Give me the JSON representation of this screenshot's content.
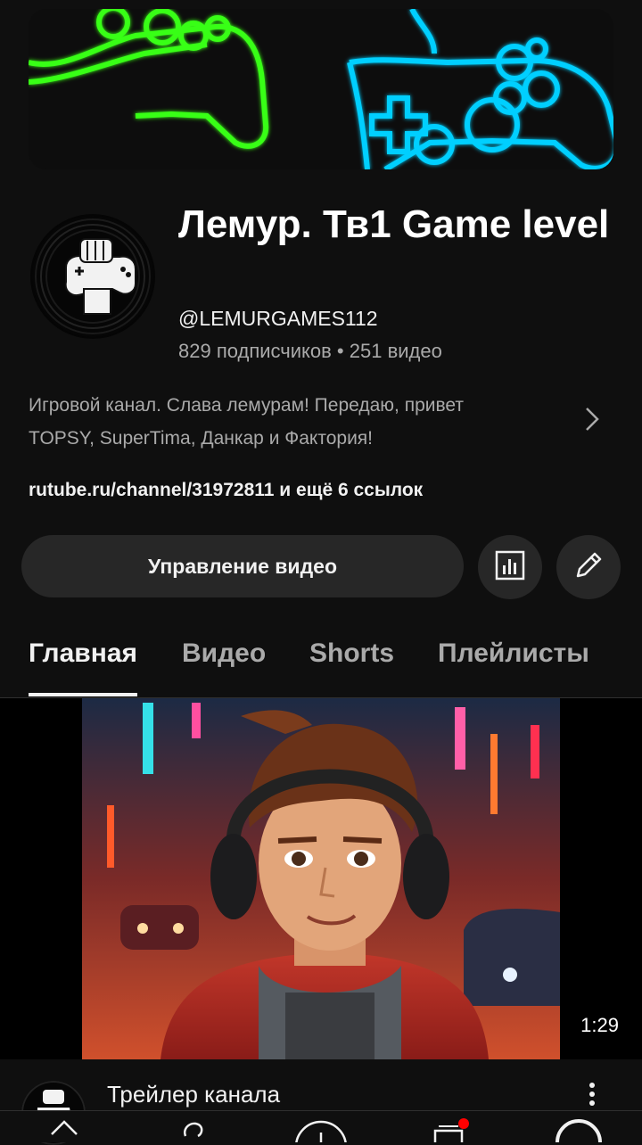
{
  "channel": {
    "name": "Лемур. Тв1 Game level",
    "handle": "@LEMURGAMES112",
    "stats": "829 подписчиков • 251 видео",
    "description_line1": "Игровой канал. Слава лемурам! Передаю, привет",
    "description_line2": "TOPSY, SuperTima, Данкар и Фактория!",
    "links": "rutube.ru/channel/31972811 и ещё 6 ссылок"
  },
  "actions": {
    "manage_label": "Управление видео",
    "analytics_icon": "bar-chart-icon",
    "edit_icon": "pencil-icon"
  },
  "tabs": [
    {
      "label": "Главная",
      "active": true
    },
    {
      "label": "Видео",
      "active": false
    },
    {
      "label": "Shorts",
      "active": false
    },
    {
      "label": "Плейлисты",
      "active": false
    }
  ],
  "featured": {
    "duration": "1:29",
    "title": "Трейлер канала"
  },
  "colors": {
    "background": "#0f0f0f",
    "banner_green": "#39ff14",
    "banner_blue": "#00cfff",
    "notification": "#ff0000"
  }
}
